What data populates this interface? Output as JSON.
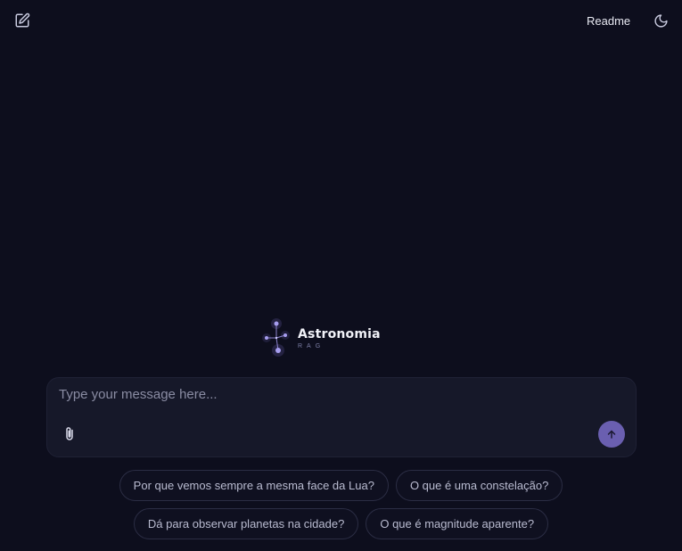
{
  "header": {
    "readme_label": "Readme"
  },
  "brand": {
    "title": "Astronomia",
    "subtitle": "RAG"
  },
  "composer": {
    "placeholder": "Type your message here..."
  },
  "suggestions": [
    [
      "Por que vemos sempre a mesma face da Lua?",
      "O que é uma constelação?"
    ],
    [
      "Dá para observar planetas na cidade?",
      "O que é magnitude aparente?"
    ]
  ],
  "icons": {
    "new_chat": "pencil-square-icon",
    "theme": "moon-icon",
    "attach": "paperclip-icon",
    "send": "arrow-up-icon",
    "logo": "constellation-icon"
  },
  "colors": {
    "background": "#0d0e1d",
    "composer": "#161829",
    "accent": "#6a5fb0"
  }
}
